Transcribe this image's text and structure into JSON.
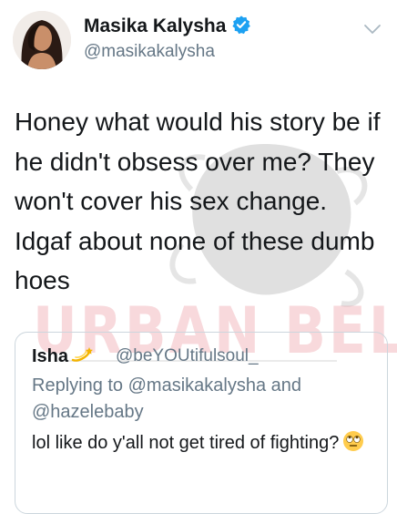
{
  "author": {
    "display_name": "Masika Kalysha",
    "handle": "@masikakalysha",
    "verified_icon": "verified-badge-icon",
    "accent": "#1da1f2"
  },
  "tweet": {
    "text": "Honey what would his story be if he didn't obsess over me? They won't cover his sex change. Idgaf about none of these dumb hoes"
  },
  "watermark": {
    "text": "URBAN BELLE"
  },
  "quoted": {
    "display_name": "Isha",
    "name_emoji_icon": "dizzy-emoji-icon",
    "handle": "@beYOUtifulsoul_",
    "replying_prefix": "Replying to",
    "reply_mention_1": "@masikakalysha",
    "reply_conjunction": "and",
    "reply_mention_2": "@hazelebaby",
    "text": "lol like do y'all not get tired of fighting?",
    "text_emoji_icon": "eye-roll-emoji-icon"
  },
  "colors": {
    "text_primary": "#14171a",
    "text_secondary": "#657786",
    "border": "#ccd6dd"
  }
}
